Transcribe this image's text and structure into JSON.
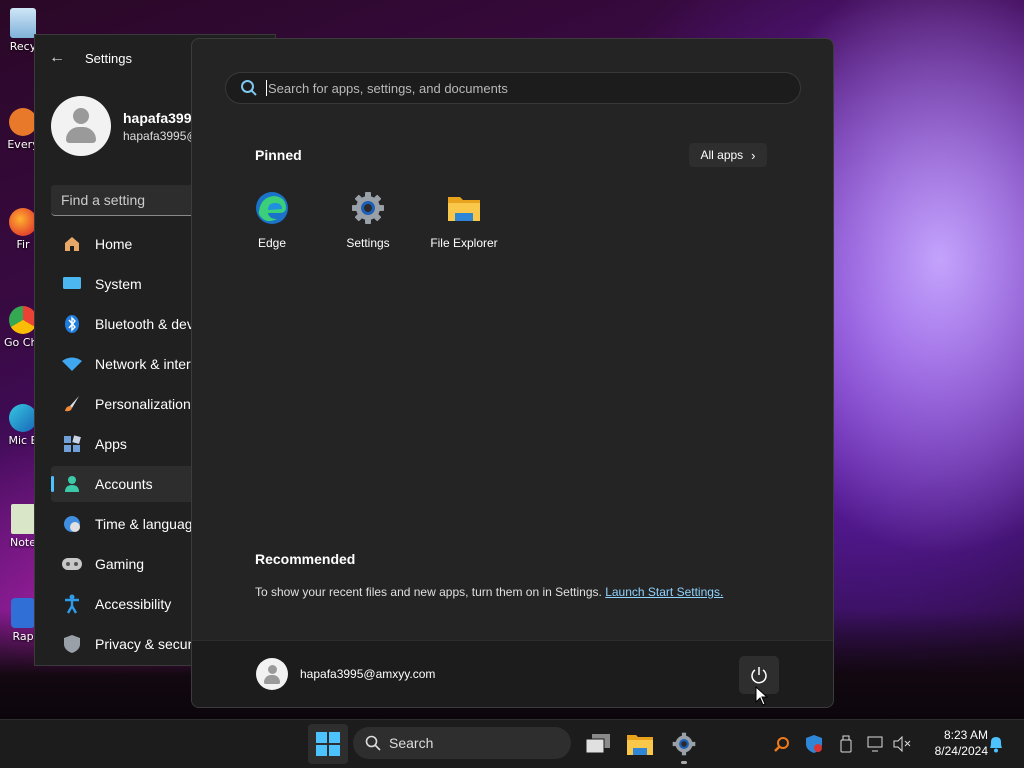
{
  "desktop": {
    "icons": [
      {
        "label": "Recy"
      },
      {
        "label": "Every"
      },
      {
        "label": "Fir"
      },
      {
        "label": "Go Chr"
      },
      {
        "label": "Mic E"
      },
      {
        "label": "Note"
      },
      {
        "label": "Rap"
      }
    ]
  },
  "settings": {
    "title": "Settings",
    "user_name": "hapafa3995",
    "user_email": "hapafa3995@",
    "find_placeholder": "Find a setting",
    "nav": [
      {
        "label": "Home",
        "icon": "home-icon"
      },
      {
        "label": "System",
        "icon": "system-icon"
      },
      {
        "label": "Bluetooth & dev",
        "icon": "bluetooth-icon"
      },
      {
        "label": "Network & inter",
        "icon": "network-icon"
      },
      {
        "label": "Personalization",
        "icon": "personalization-icon"
      },
      {
        "label": "Apps",
        "icon": "apps-icon"
      },
      {
        "label": "Accounts",
        "icon": "accounts-icon",
        "active": true
      },
      {
        "label": "Time & languag",
        "icon": "time-language-icon"
      },
      {
        "label": "Gaming",
        "icon": "gaming-icon"
      },
      {
        "label": "Accessibility",
        "icon": "accessibility-icon"
      },
      {
        "label": "Privacy & securi",
        "icon": "privacy-icon"
      }
    ]
  },
  "start_menu": {
    "search_placeholder": "Search for apps, settings, and documents",
    "pinned_title": "Pinned",
    "all_apps_label": "All apps",
    "pinned": [
      {
        "label": "Edge",
        "icon": "edge-icon"
      },
      {
        "label": "Settings",
        "icon": "settings-gear-icon"
      },
      {
        "label": "File Explorer",
        "icon": "file-explorer-icon"
      }
    ],
    "recommended_title": "Recommended",
    "recommended_text": "To show your recent files and new apps, turn them on in Settings.",
    "recommended_link": "Launch Start Settings.",
    "user_email": "hapafa3995@amxyy.com"
  },
  "taskbar": {
    "search_label": "Search",
    "time": "8:23 AM",
    "date": "8/24/2024"
  },
  "colors": {
    "accent": "#4cc2ff",
    "start_bg": "#242424",
    "taskbar_bg": "#1c1c1c"
  }
}
